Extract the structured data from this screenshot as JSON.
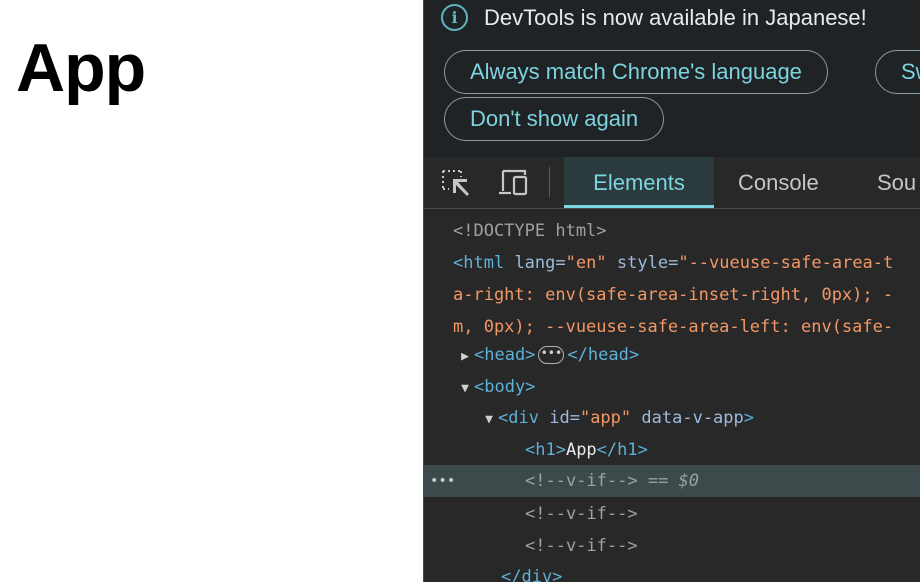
{
  "page": {
    "heading": "App"
  },
  "devtools": {
    "infobar": {
      "icon": "info-icon",
      "icon_glyph": "i",
      "message": "DevTools is now available in Japanese!",
      "always_match_label": "Always match Chrome's language",
      "switch_label": "Sw",
      "dont_show_label": "Don't show again"
    },
    "toolbar": {
      "inspect_icon": "inspect-element-icon",
      "device_icon": "device-toolbar-icon",
      "tabs": [
        {
          "label": "Elements",
          "active": true
        },
        {
          "label": "Console",
          "active": false
        },
        {
          "label": "Sou",
          "active": false
        }
      ]
    },
    "tree": {
      "doctype": "<!DOCTYPE html>",
      "html_open": "<html",
      "html_lang_attr": "lang",
      "html_lang_val": "en",
      "html_style_attr": "style",
      "html_style_val_1": "--vueuse-safe-area-t",
      "html_style_val_2": "a-right: env(safe-area-inset-right, 0px); -",
      "html_style_val_3": "m, 0px); --vueuse-safe-area-left: env(safe-",
      "head_open": "<head>",
      "head_close": "</head>",
      "head_ellipsis": "•••",
      "body_open": "<body>",
      "div_open": "<div",
      "div_id_attr": "id",
      "div_id_val": "app",
      "div_flag_attr": "data-v-app",
      "div_end": ">",
      "h1_open": "<h1>",
      "h1_text": "App",
      "h1_close": "</h1>",
      "comment_1": "<!--v-if-->",
      "selected_marker": "== $0",
      "comment_2": "<!--v-if-->",
      "comment_3": "<!--v-if-->",
      "div_close": "</div>",
      "gutter_dots": "•••"
    },
    "colors": {
      "tag": "#5db0d7",
      "attr": "#9bbbdc",
      "value": "#f29766",
      "accent": "#7cd4e0"
    }
  }
}
